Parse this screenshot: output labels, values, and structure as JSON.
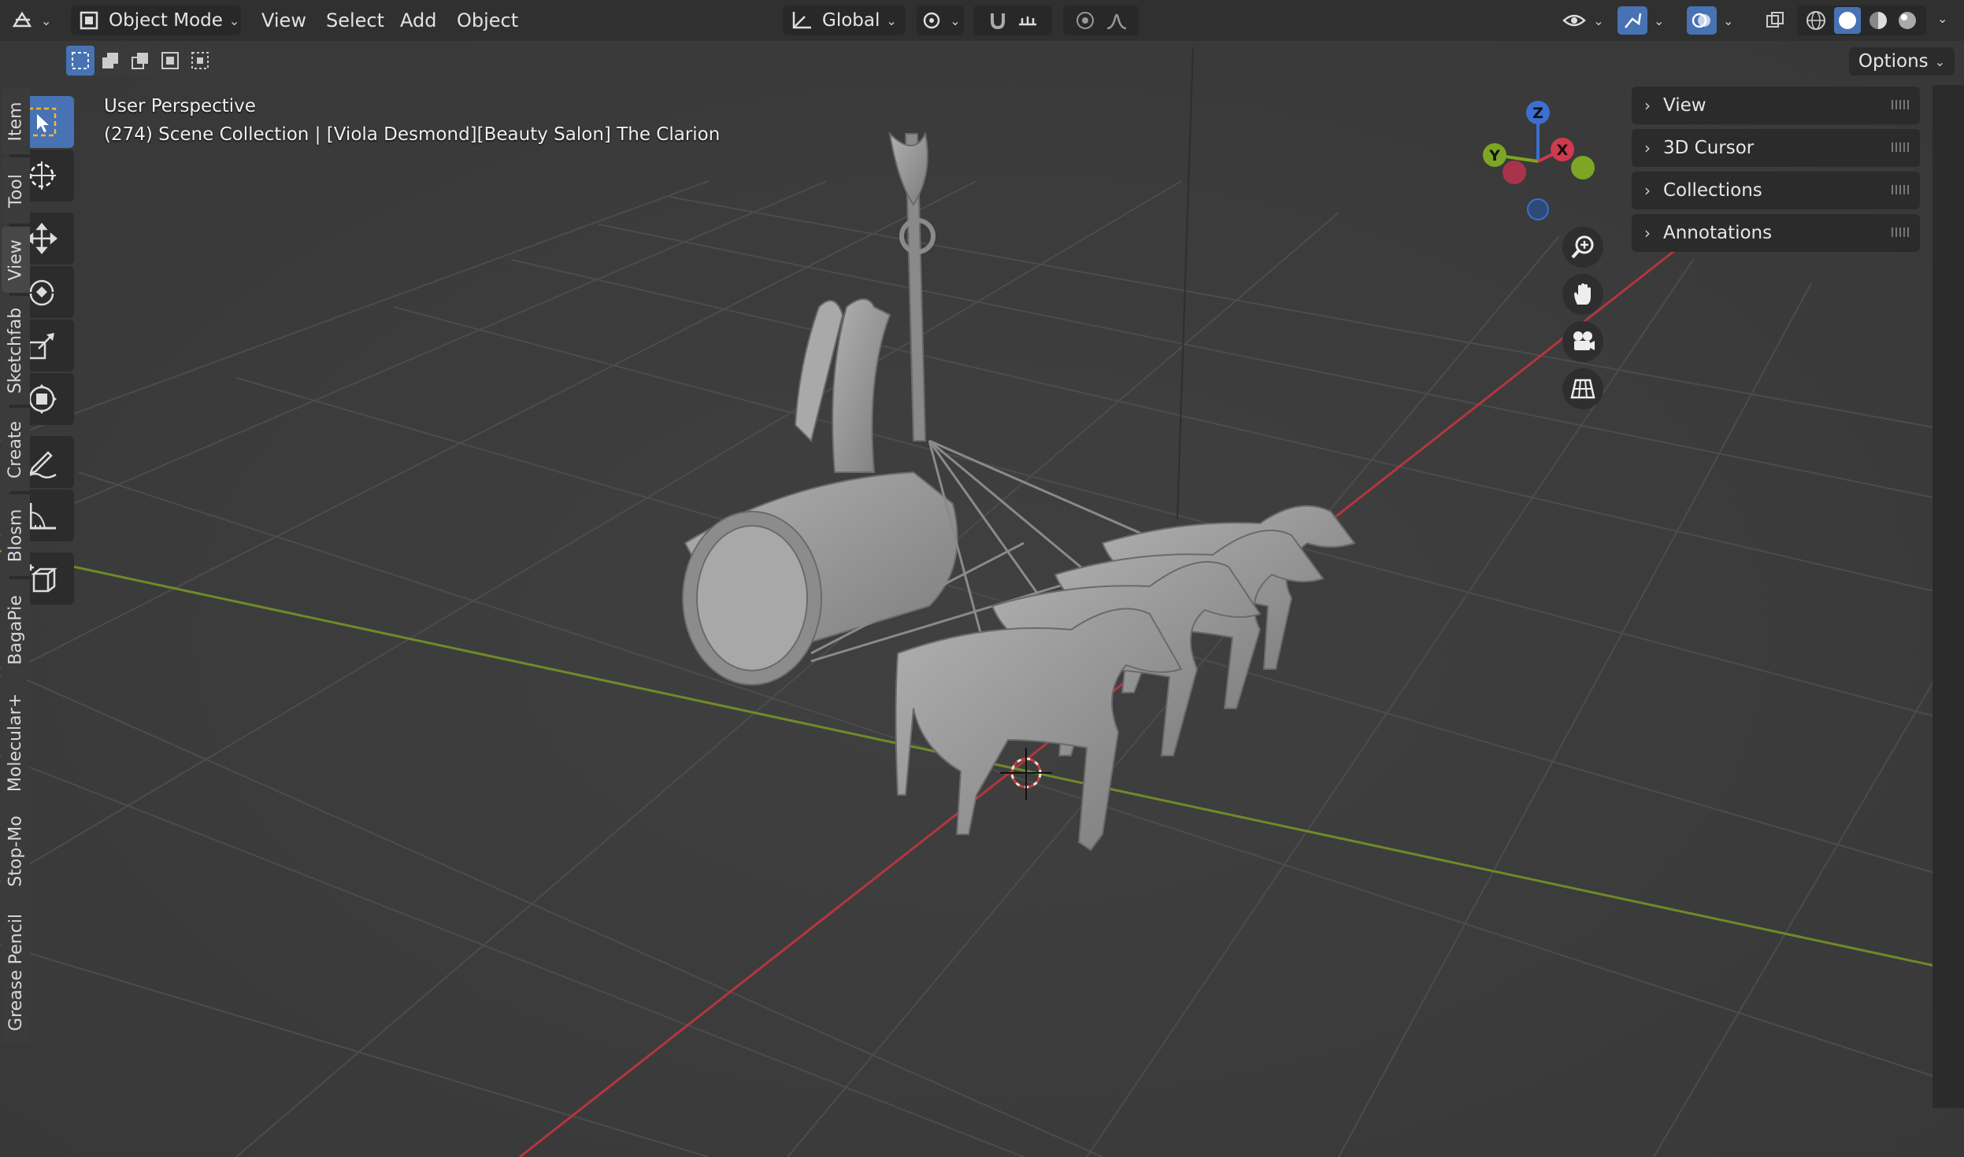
{
  "header": {
    "mode_label": "Object Mode",
    "menus": [
      "View",
      "Select",
      "Add",
      "Object"
    ],
    "orientation_label": "Global",
    "options_label": "Options"
  },
  "viewport": {
    "perspective_label": "User Perspective",
    "collection_label": "(274) Scene Collection | [Viola Desmond][Beauty Salon] The Clarion"
  },
  "gizmo": {
    "axes": [
      {
        "label": "Z",
        "color": "#3b6fd1"
      },
      {
        "label": "Y",
        "color": "#7ca624"
      },
      {
        "label": "X",
        "color": "#d0394e"
      }
    ]
  },
  "npanel": {
    "sections": [
      "View",
      "3D Cursor",
      "Collections",
      "Annotations"
    ]
  },
  "side_tabs": [
    "Item",
    "Tool",
    "View",
    "Sketchfab",
    "Create",
    "Blosm",
    "BagaPie",
    "Molecular+",
    "Stop-Mo",
    "Grease Pencil"
  ],
  "active_side_tab": "View",
  "tools": [
    {
      "name": "select-box-tool",
      "icon": "select-box-icon",
      "active": true
    },
    {
      "name": "cursor-tool",
      "icon": "cursor-icon",
      "active": false
    },
    {
      "name": "move-tool",
      "icon": "move-icon",
      "active": false
    },
    {
      "name": "rotate-tool",
      "icon": "rotate-icon",
      "active": false
    },
    {
      "name": "scale-tool",
      "icon": "scale-icon",
      "active": false
    },
    {
      "name": "transform-tool",
      "icon": "transform-icon",
      "active": false
    },
    {
      "name": "annotate-tool",
      "icon": "annotate-icon",
      "active": false
    },
    {
      "name": "measure-tool",
      "icon": "measure-icon",
      "active": false
    },
    {
      "name": "add-cube-tool",
      "icon": "add-cube-icon",
      "active": false
    }
  ],
  "colors": {
    "accent": "#4772b3",
    "x_axis_line": "#b3363f",
    "y_axis_line": "#6f8a2a",
    "model": "#9c9c9c"
  }
}
